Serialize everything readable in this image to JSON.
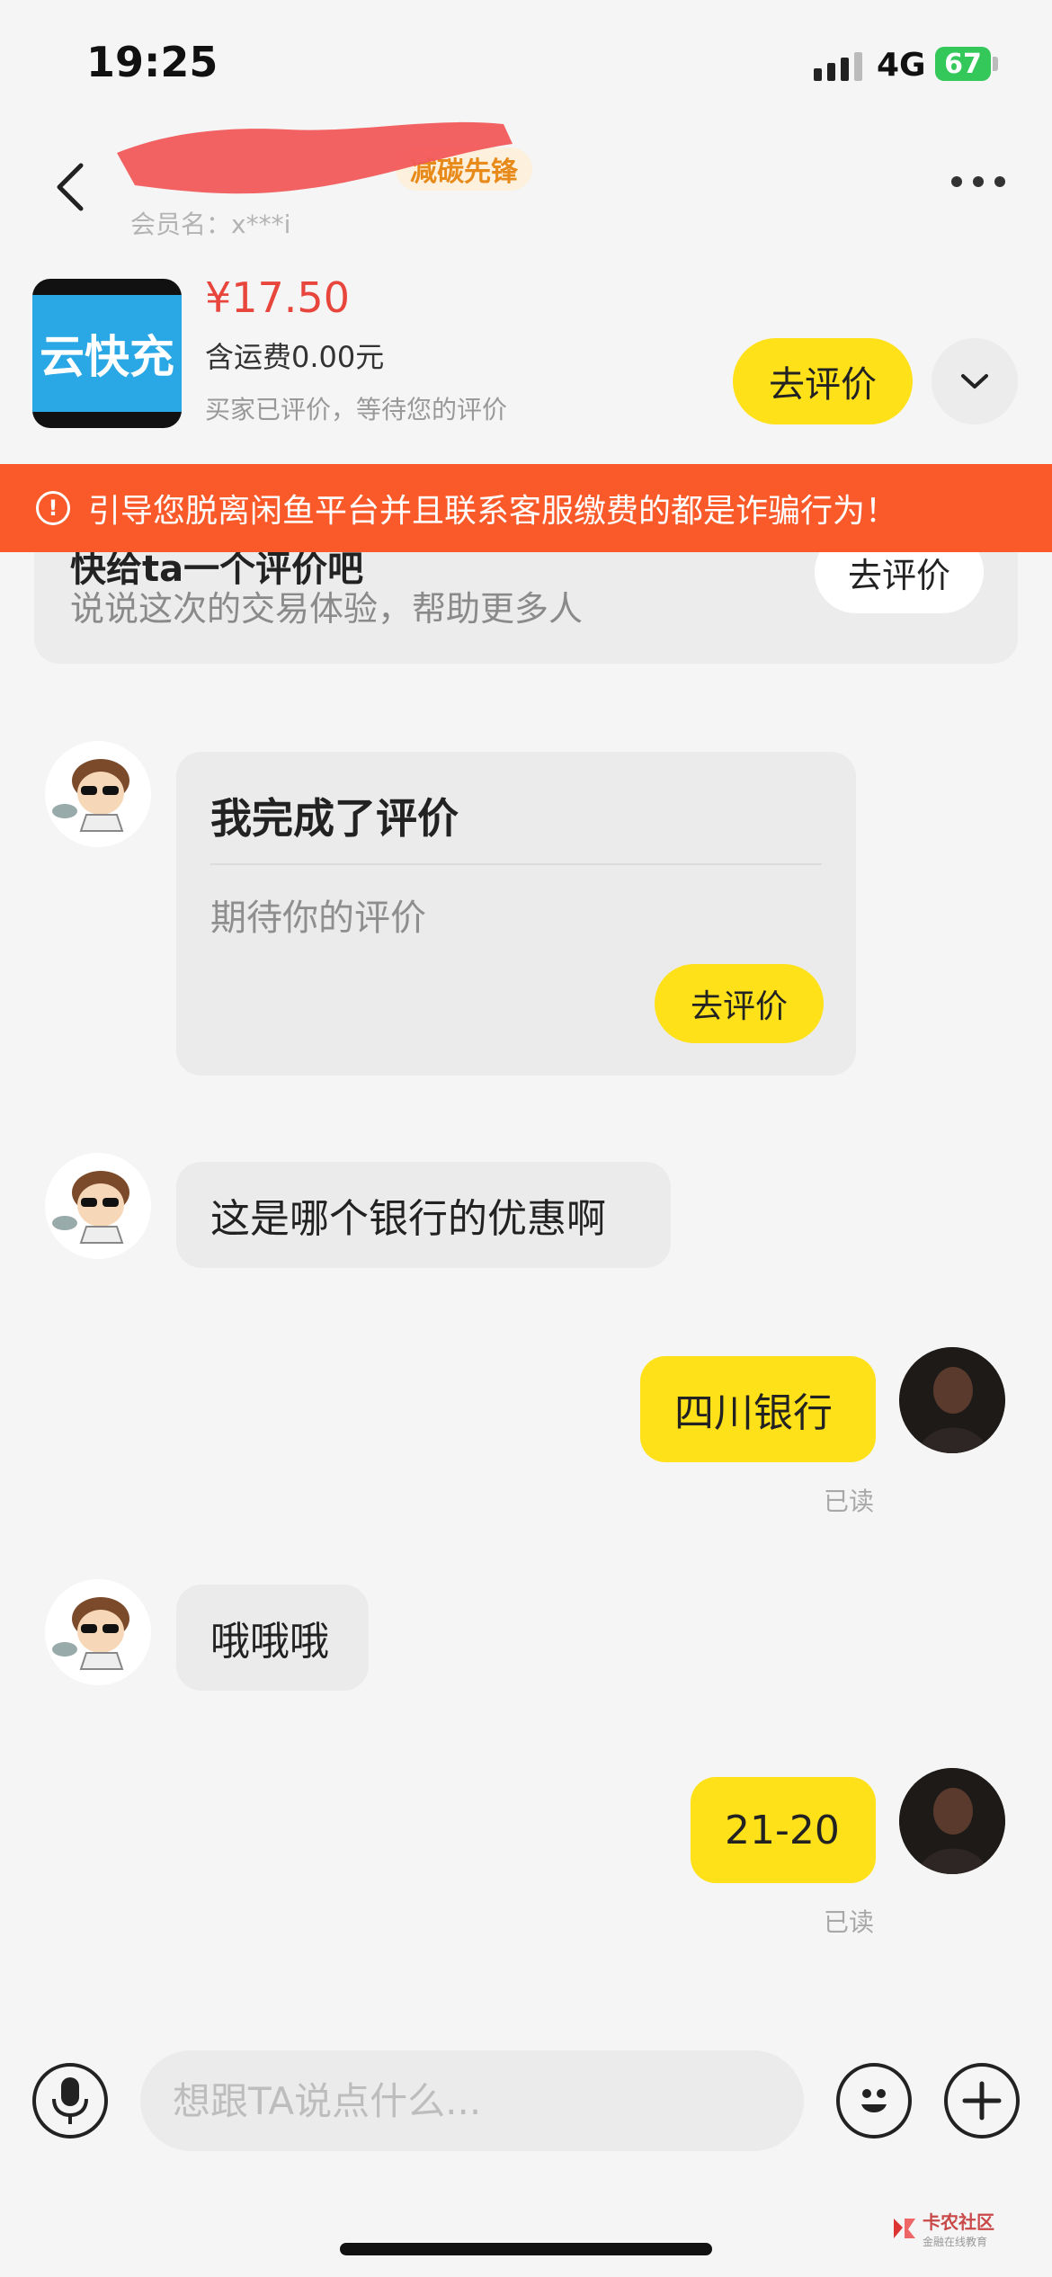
{
  "status_bar": {
    "time": "19:25",
    "network": "4G",
    "battery": "67"
  },
  "header": {
    "badge": "减碳先锋",
    "member_label": "会员名：x***i"
  },
  "product": {
    "thumbnail_text": "云快充",
    "price": "¥17.50",
    "shipping": "含运费0.00元",
    "status": "买家已评价，等待您的评价",
    "review_button": "去评价"
  },
  "warning": {
    "text": "引导您脱离闲鱼平台并且联系客服缴费的都是诈骗行为！"
  },
  "eval_card": {
    "title": "快给ta一个评价吧",
    "subtitle": "说说这次的交易体验，帮助更多人",
    "button": "去评价"
  },
  "messages": [
    {
      "from": "other",
      "type": "review",
      "title": "我完成了评价",
      "subtitle": "期待你的评价",
      "button": "去评价"
    },
    {
      "from": "other",
      "type": "text",
      "text": "这是哪个银行的优惠啊"
    },
    {
      "from": "me",
      "type": "text",
      "text": "四川银行",
      "status": "已读"
    },
    {
      "from": "other",
      "type": "text",
      "text": "哦哦哦"
    },
    {
      "from": "me",
      "type": "text",
      "text": "21-20",
      "status": "已读"
    }
  ],
  "input": {
    "placeholder": "想跟TA说点什么..."
  },
  "watermark": {
    "title": "卡农社区",
    "subtitle": "金融在线教育"
  },
  "colors": {
    "accent_yellow": "#ffe11a",
    "warning_orange": "#fa5a2a",
    "price_red": "#e8453c"
  }
}
